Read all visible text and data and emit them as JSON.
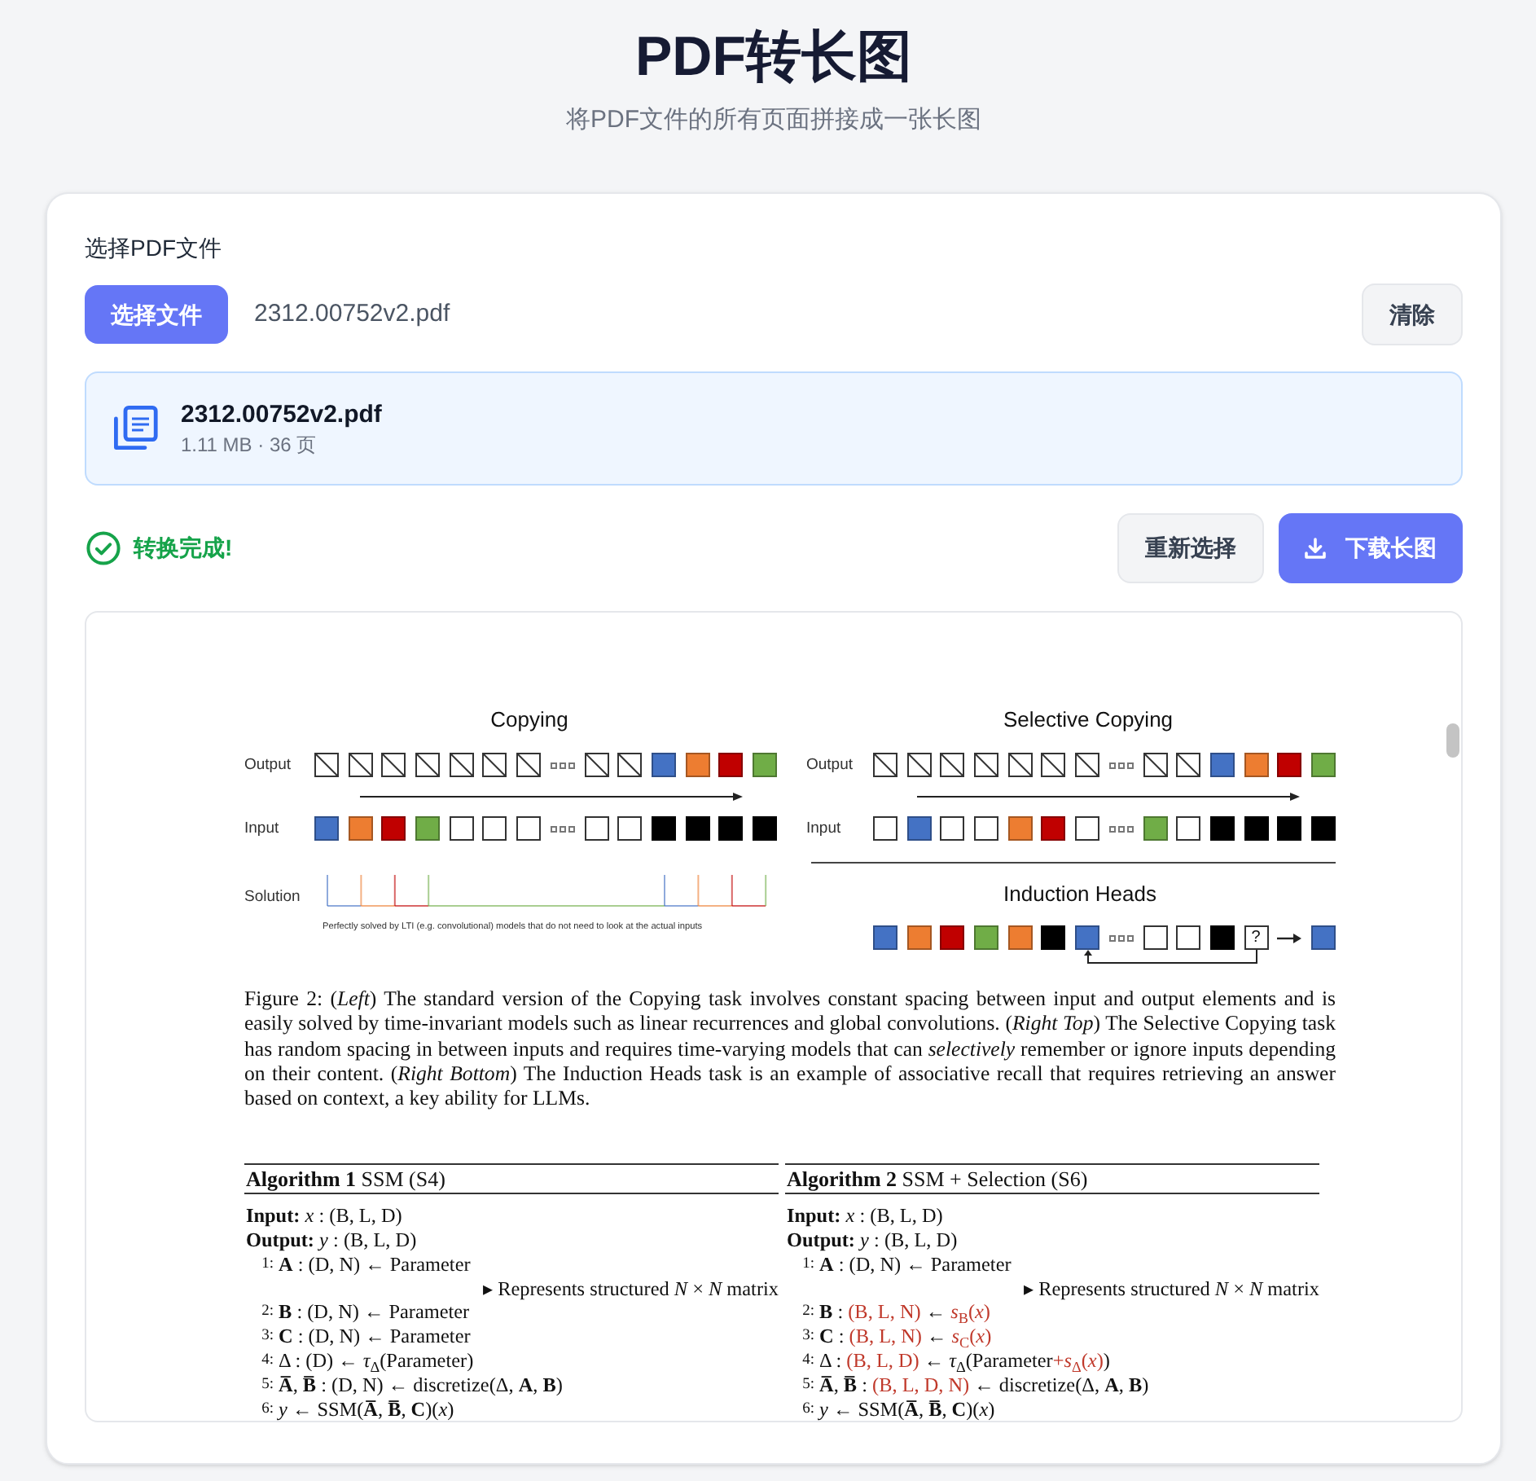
{
  "header": {
    "title": "PDF转长图",
    "subtitle": "将PDF文件的所有页面拼接成一张长图"
  },
  "file_picker": {
    "label": "选择PDF文件",
    "choose_button": "选择文件",
    "file_name": "2312.00752v2.pdf",
    "clear_button": "清除"
  },
  "file_card": {
    "name": "2312.00752v2.pdf",
    "meta": "1.11 MB · 36 页"
  },
  "status": {
    "kind": "success",
    "text": "转换完成!"
  },
  "actions": [
    {
      "kind": "secondary",
      "label": "重新选择"
    },
    {
      "kind": "primary",
      "label": "下载长图"
    }
  ],
  "preview": {
    "figure": {
      "copying": {
        "title": "Copying",
        "rows": [
          {
            "label": "Output",
            "cells": [
              {
                "kind": "slash"
              },
              {
                "kind": "slash"
              },
              {
                "kind": "slash"
              },
              {
                "kind": "slash"
              },
              {
                "kind": "slash"
              },
              {
                "kind": "slash"
              },
              {
                "kind": "slash"
              },
              {
                "kind": "dots"
              },
              {
                "kind": "slash"
              },
              {
                "kind": "slash"
              },
              {
                "kind": "fill",
                "color": "#4472c4"
              },
              {
                "kind": "fill",
                "color": "#ed7d31"
              },
              {
                "kind": "fill",
                "color": "#c00000"
              },
              {
                "kind": "fill",
                "color": "#70ad47"
              }
            ]
          },
          {
            "label": "Input",
            "cells": [
              {
                "kind": "fill",
                "color": "#4472c4"
              },
              {
                "kind": "fill",
                "color": "#ed7d31"
              },
              {
                "kind": "fill",
                "color": "#c00000"
              },
              {
                "kind": "fill",
                "color": "#70ad47"
              },
              {
                "kind": "empty"
              },
              {
                "kind": "empty"
              },
              {
                "kind": "empty"
              },
              {
                "kind": "dots"
              },
              {
                "kind": "empty"
              },
              {
                "kind": "empty"
              },
              {
                "kind": "marker"
              },
              {
                "kind": "marker"
              },
              {
                "kind": "marker"
              },
              {
                "kind": "marker"
              }
            ]
          }
        ],
        "solution": {
          "label": "Solution",
          "note": "Perfectly solved by LTI (e.g. convolutional) models that do not need to look at the actual inputs"
        }
      },
      "selective_copying": {
        "title": "Selective Copying",
        "rows": [
          {
            "label": "Output",
            "cells": [
              {
                "kind": "slash"
              },
              {
                "kind": "slash"
              },
              {
                "kind": "slash"
              },
              {
                "kind": "slash"
              },
              {
                "kind": "slash"
              },
              {
                "kind": "slash"
              },
              {
                "kind": "slash"
              },
              {
                "kind": "dots"
              },
              {
                "kind": "slash"
              },
              {
                "kind": "slash"
              },
              {
                "kind": "fill",
                "color": "#4472c4"
              },
              {
                "kind": "fill",
                "color": "#ed7d31"
              },
              {
                "kind": "fill",
                "color": "#c00000"
              },
              {
                "kind": "fill",
                "color": "#70ad47"
              }
            ]
          },
          {
            "label": "Input",
            "cells": [
              {
                "kind": "empty"
              },
              {
                "kind": "fill",
                "color": "#4472c4"
              },
              {
                "kind": "empty"
              },
              {
                "kind": "empty"
              },
              {
                "kind": "fill",
                "color": "#ed7d31"
              },
              {
                "kind": "fill",
                "color": "#c00000"
              },
              {
                "kind": "empty"
              },
              {
                "kind": "dots"
              },
              {
                "kind": "fill",
                "color": "#70ad47"
              },
              {
                "kind": "empty"
              },
              {
                "kind": "marker"
              },
              {
                "kind": "marker"
              },
              {
                "kind": "marker"
              },
              {
                "kind": "marker"
              }
            ]
          }
        ]
      },
      "induction_heads": {
        "title": "Induction Heads",
        "cells": [
          {
            "kind": "fill",
            "color": "#4472c4"
          },
          {
            "kind": "fill",
            "color": "#ed7d31"
          },
          {
            "kind": "fill",
            "color": "#c00000"
          },
          {
            "kind": "fill",
            "color": "#70ad47"
          },
          {
            "kind": "fill",
            "color": "#ed7d31"
          },
          {
            "kind": "marker"
          },
          {
            "kind": "target",
            "color": "#4472c4"
          },
          {
            "kind": "dots"
          },
          {
            "kind": "empty"
          },
          {
            "kind": "empty"
          },
          {
            "kind": "marker"
          },
          {
            "kind": "query",
            "text": "?"
          },
          {
            "kind": "arrow"
          },
          {
            "kind": "fill",
            "color": "#4472c4"
          }
        ]
      }
    },
    "caption": "Figure 2: (*Left*) The standard version of the Copying task involves constant spacing between input and output elements and is easily solved by time-invariant models such as linear recurrences and global convolutions. (*Right Top*) The Selective Copying task has random spacing in between inputs and requires time-varying models that can *selectively* remember or ignore inputs depending on their content. (*Right Bottom*) The Induction Heads task is an example of associative recall that requires retrieving an answer based on context, a key ability for LLMs.",
    "algorithms": [
      {
        "title": "**Algorithm 1** SSM (S4)",
        "lines": [
          {
            "kind": "io",
            "text": "**Input:** *x* : (B, L, D)"
          },
          {
            "kind": "io",
            "text": "**Output:** *y* : (B, L, D)"
          },
          {
            "kind": "step",
            "number": "1:",
            "parts": [
              {
                "text": "**A** : (D, N) ← Parameter",
                "highlight": false
              }
            ]
          },
          {
            "kind": "comment",
            "text": "▸ Represents structured *N* × *N* matrix"
          },
          {
            "kind": "step",
            "number": "2:",
            "parts": [
              {
                "text": "**B** : (D, N) ← Parameter",
                "highlight": false
              }
            ]
          },
          {
            "kind": "step",
            "number": "3:",
            "parts": [
              {
                "text": "**C** : (D, N) ← Parameter",
                "highlight": false
              }
            ]
          },
          {
            "kind": "step",
            "number": "4:",
            "parts": [
              {
                "text": "Δ : (D) ← *τ*$_{Δ}$(Parameter)",
                "highlight": false
              }
            ]
          },
          {
            "kind": "step",
            "number": "5:",
            "parts": [
              {
                "text": "**A̅**, **B̅** : (D, N) ← discretize(Δ, **A**, **B**)",
                "highlight": false
              }
            ]
          },
          {
            "kind": "step",
            "number": "6:",
            "parts": [
              {
                "text": "*y* ← SSM(**A̅**, **B̅**, **C**)(*x*)",
                "highlight": false
              }
            ]
          }
        ]
      },
      {
        "title": "**Algorithm 2** SSM + Selection (S6)",
        "lines": [
          {
            "kind": "io",
            "text": "**Input:** *x* : (B, L, D)"
          },
          {
            "kind": "io",
            "text": "**Output:** *y* : (B, L, D)"
          },
          {
            "kind": "step",
            "number": "1:",
            "parts": [
              {
                "text": "**A** : (D, N) ← Parameter",
                "highlight": false
              }
            ]
          },
          {
            "kind": "comment",
            "text": "▸ Represents structured *N* × *N* matrix"
          },
          {
            "kind": "step",
            "number": "2:",
            "parts": [
              {
                "text": "**B** : ",
                "highlight": false
              },
              {
                "text": "(B, L, N)",
                "highlight": true
              },
              {
                "text": " ← ",
                "highlight": false
              },
              {
                "text": "*s*$_{B}$(*x*)",
                "highlight": true
              }
            ]
          },
          {
            "kind": "step",
            "number": "3:",
            "parts": [
              {
                "text": "**C** : ",
                "highlight": false
              },
              {
                "text": "(B, L, N)",
                "highlight": true
              },
              {
                "text": " ← ",
                "highlight": false
              },
              {
                "text": "*s*$_{C}$(*x*)",
                "highlight": true
              }
            ]
          },
          {
            "kind": "step",
            "number": "4:",
            "parts": [
              {
                "text": "Δ : ",
                "highlight": false
              },
              {
                "text": "(B, L, D)",
                "highlight": true
              },
              {
                "text": " ← *τ*$_{Δ}$(Parameter",
                "highlight": false
              },
              {
                "text": "+*s*$_{Δ}$(*x*)",
                "highlight": true
              },
              {
                "text": ")",
                "highlight": false
              }
            ]
          },
          {
            "kind": "step",
            "number": "5:",
            "parts": [
              {
                "text": "**A̅**, **B̅** : ",
                "highlight": false
              },
              {
                "text": "(B, L, D, N)",
                "highlight": true
              },
              {
                "text": " ← discretize(Δ, **A**, **B**)",
                "highlight": false
              }
            ]
          },
          {
            "kind": "step",
            "number": "6:",
            "parts": [
              {
                "text": "*y* ← SSM(**A̅**, **B̅**, **C**)(*x*)",
                "highlight": false
              }
            ]
          }
        ]
      }
    ]
  }
}
